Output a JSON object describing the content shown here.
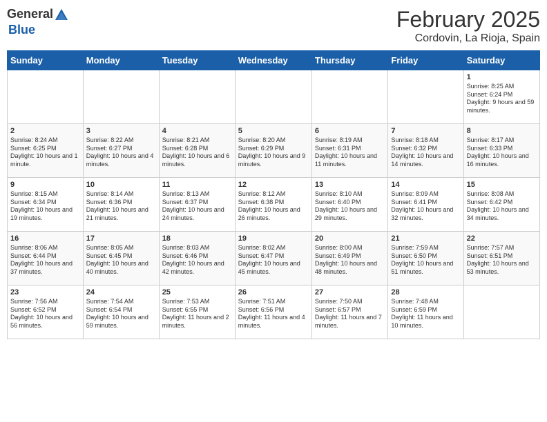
{
  "logo": {
    "general": "General",
    "blue": "Blue"
  },
  "header": {
    "title": "February 2025",
    "subtitle": "Cordovin, La Rioja, Spain"
  },
  "weekdays": [
    "Sunday",
    "Monday",
    "Tuesday",
    "Wednesday",
    "Thursday",
    "Friday",
    "Saturday"
  ],
  "days": [
    {
      "date": "",
      "info": ""
    },
    {
      "date": "",
      "info": ""
    },
    {
      "date": "",
      "info": ""
    },
    {
      "date": "",
      "info": ""
    },
    {
      "date": "",
      "info": ""
    },
    {
      "date": "",
      "info": ""
    },
    {
      "date": "1",
      "info": "Sunrise: 8:25 AM\nSunset: 6:24 PM\nDaylight: 9 hours and 59 minutes."
    },
    {
      "date": "2",
      "info": "Sunrise: 8:24 AM\nSunset: 6:25 PM\nDaylight: 10 hours and 1 minute."
    },
    {
      "date": "3",
      "info": "Sunrise: 8:22 AM\nSunset: 6:27 PM\nDaylight: 10 hours and 4 minutes."
    },
    {
      "date": "4",
      "info": "Sunrise: 8:21 AM\nSunset: 6:28 PM\nDaylight: 10 hours and 6 minutes."
    },
    {
      "date": "5",
      "info": "Sunrise: 8:20 AM\nSunset: 6:29 PM\nDaylight: 10 hours and 9 minutes."
    },
    {
      "date": "6",
      "info": "Sunrise: 8:19 AM\nSunset: 6:31 PM\nDaylight: 10 hours and 11 minutes."
    },
    {
      "date": "7",
      "info": "Sunrise: 8:18 AM\nSunset: 6:32 PM\nDaylight: 10 hours and 14 minutes."
    },
    {
      "date": "8",
      "info": "Sunrise: 8:17 AM\nSunset: 6:33 PM\nDaylight: 10 hours and 16 minutes."
    },
    {
      "date": "9",
      "info": "Sunrise: 8:15 AM\nSunset: 6:34 PM\nDaylight: 10 hours and 19 minutes."
    },
    {
      "date": "10",
      "info": "Sunrise: 8:14 AM\nSunset: 6:36 PM\nDaylight: 10 hours and 21 minutes."
    },
    {
      "date": "11",
      "info": "Sunrise: 8:13 AM\nSunset: 6:37 PM\nDaylight: 10 hours and 24 minutes."
    },
    {
      "date": "12",
      "info": "Sunrise: 8:12 AM\nSunset: 6:38 PM\nDaylight: 10 hours and 26 minutes."
    },
    {
      "date": "13",
      "info": "Sunrise: 8:10 AM\nSunset: 6:40 PM\nDaylight: 10 hours and 29 minutes."
    },
    {
      "date": "14",
      "info": "Sunrise: 8:09 AM\nSunset: 6:41 PM\nDaylight: 10 hours and 32 minutes."
    },
    {
      "date": "15",
      "info": "Sunrise: 8:08 AM\nSunset: 6:42 PM\nDaylight: 10 hours and 34 minutes."
    },
    {
      "date": "16",
      "info": "Sunrise: 8:06 AM\nSunset: 6:44 PM\nDaylight: 10 hours and 37 minutes."
    },
    {
      "date": "17",
      "info": "Sunrise: 8:05 AM\nSunset: 6:45 PM\nDaylight: 10 hours and 40 minutes."
    },
    {
      "date": "18",
      "info": "Sunrise: 8:03 AM\nSunset: 6:46 PM\nDaylight: 10 hours and 42 minutes."
    },
    {
      "date": "19",
      "info": "Sunrise: 8:02 AM\nSunset: 6:47 PM\nDaylight: 10 hours and 45 minutes."
    },
    {
      "date": "20",
      "info": "Sunrise: 8:00 AM\nSunset: 6:49 PM\nDaylight: 10 hours and 48 minutes."
    },
    {
      "date": "21",
      "info": "Sunrise: 7:59 AM\nSunset: 6:50 PM\nDaylight: 10 hours and 51 minutes."
    },
    {
      "date": "22",
      "info": "Sunrise: 7:57 AM\nSunset: 6:51 PM\nDaylight: 10 hours and 53 minutes."
    },
    {
      "date": "23",
      "info": "Sunrise: 7:56 AM\nSunset: 6:52 PM\nDaylight: 10 hours and 56 minutes."
    },
    {
      "date": "24",
      "info": "Sunrise: 7:54 AM\nSunset: 6:54 PM\nDaylight: 10 hours and 59 minutes."
    },
    {
      "date": "25",
      "info": "Sunrise: 7:53 AM\nSunset: 6:55 PM\nDaylight: 11 hours and 2 minutes."
    },
    {
      "date": "26",
      "info": "Sunrise: 7:51 AM\nSunset: 6:56 PM\nDaylight: 11 hours and 4 minutes."
    },
    {
      "date": "27",
      "info": "Sunrise: 7:50 AM\nSunset: 6:57 PM\nDaylight: 11 hours and 7 minutes."
    },
    {
      "date": "28",
      "info": "Sunrise: 7:48 AM\nSunset: 6:59 PM\nDaylight: 11 hours and 10 minutes."
    },
    {
      "date": "",
      "info": ""
    }
  ]
}
